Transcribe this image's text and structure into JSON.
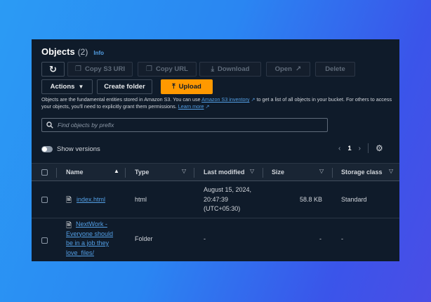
{
  "header": {
    "title": "Objects",
    "count": "(2)",
    "info": "Info"
  },
  "toolbar": {
    "refresh_icon": "refresh-icon",
    "copy_s3_uri": "Copy S3 URI",
    "copy_url": "Copy URL",
    "download": "Download",
    "open": "Open",
    "delete": "Delete",
    "actions": "Actions",
    "create_folder": "Create folder",
    "upload": "Upload"
  },
  "description": {
    "part1": "Objects are the fundamental entities stored in Amazon S3. You can use ",
    "link1": "Amazon S3 inventory",
    "part2": " to get a list of all objects in your bucket. For others to access your objects, you'll need to explicitly grant them permissions. ",
    "link2": "Learn more"
  },
  "search": {
    "placeholder": "Find objects by prefix"
  },
  "versions": {
    "label": "Show versions"
  },
  "pagination": {
    "current_page": "1"
  },
  "table": {
    "columns": {
      "name": "Name",
      "type": "Type",
      "last_modified": "Last modified",
      "size": "Size",
      "storage_class": "Storage class"
    },
    "rows": [
      {
        "name": "index.html",
        "type": "html",
        "last_modified": [
          "August 15, 2024,",
          "20:47:39",
          "(UTC+05:30)"
        ],
        "size": "58.8 KB",
        "storage_class": "Standard"
      },
      {
        "name": [
          "NextWork -",
          "Everyone should",
          "be in a job they",
          "love_files/"
        ],
        "type": "Folder",
        "last_modified": "-",
        "size": "-",
        "storage_class": "-"
      }
    ]
  },
  "colors": {
    "accent": "#ff9900",
    "link": "#539fe5",
    "panel_bg": "#0f1b2a"
  }
}
